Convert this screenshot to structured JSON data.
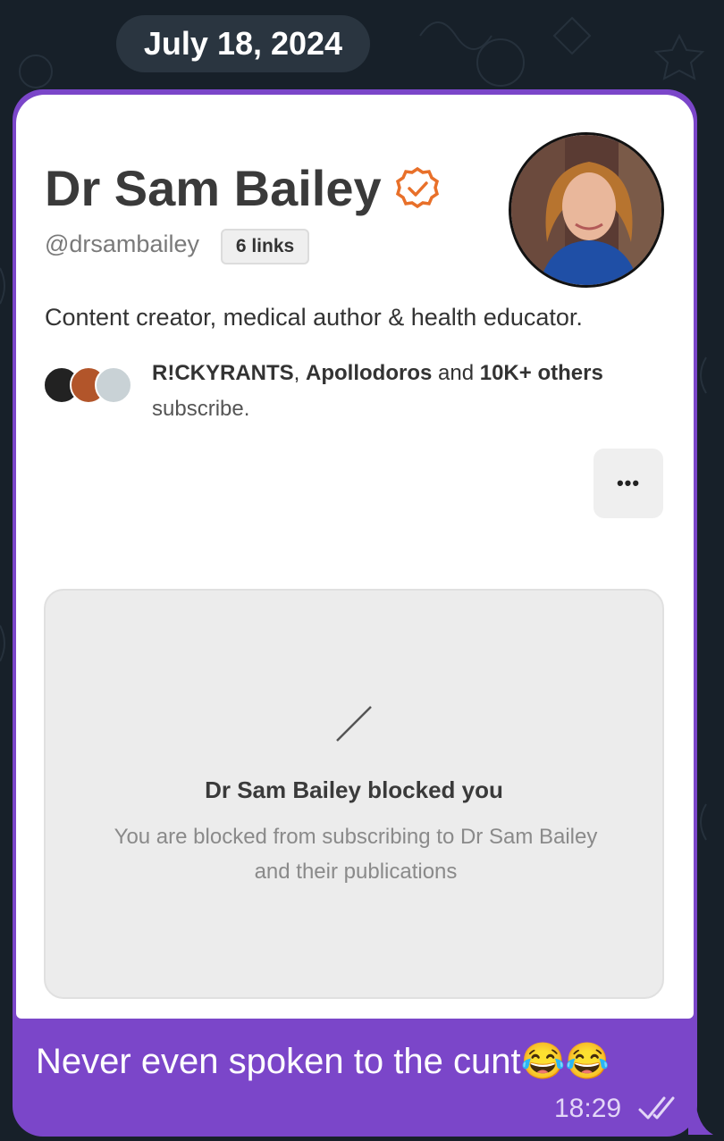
{
  "chat": {
    "date_label": "July 18, 2024",
    "profile": {
      "name": "Dr Sam Bailey",
      "handle": "@drsambailey",
      "links_badge": "6 links",
      "bio": "Content creator, medical author & health educator.",
      "subscribers": {
        "name1": "R!CKYRANTS",
        "sep": ", ",
        "name2": "Apollodoros",
        "and": " and ",
        "count": "10K+ others",
        "suffix": "subscribe."
      },
      "more_label": "•••",
      "blocked_title": "Dr Sam Bailey blocked you",
      "blocked_desc_line1": "You are blocked from subscribing to Dr Sam Bailey",
      "blocked_desc_line2": "and their publications"
    },
    "message": {
      "text": "Never even spoken to the cunt😂😂",
      "time": "18:29",
      "status_icon": "double-check-icon"
    },
    "colors": {
      "background": "#172029",
      "bubble": "#7b46c9",
      "verified": "#e8702a",
      "date_pill": "#2a3540"
    }
  }
}
